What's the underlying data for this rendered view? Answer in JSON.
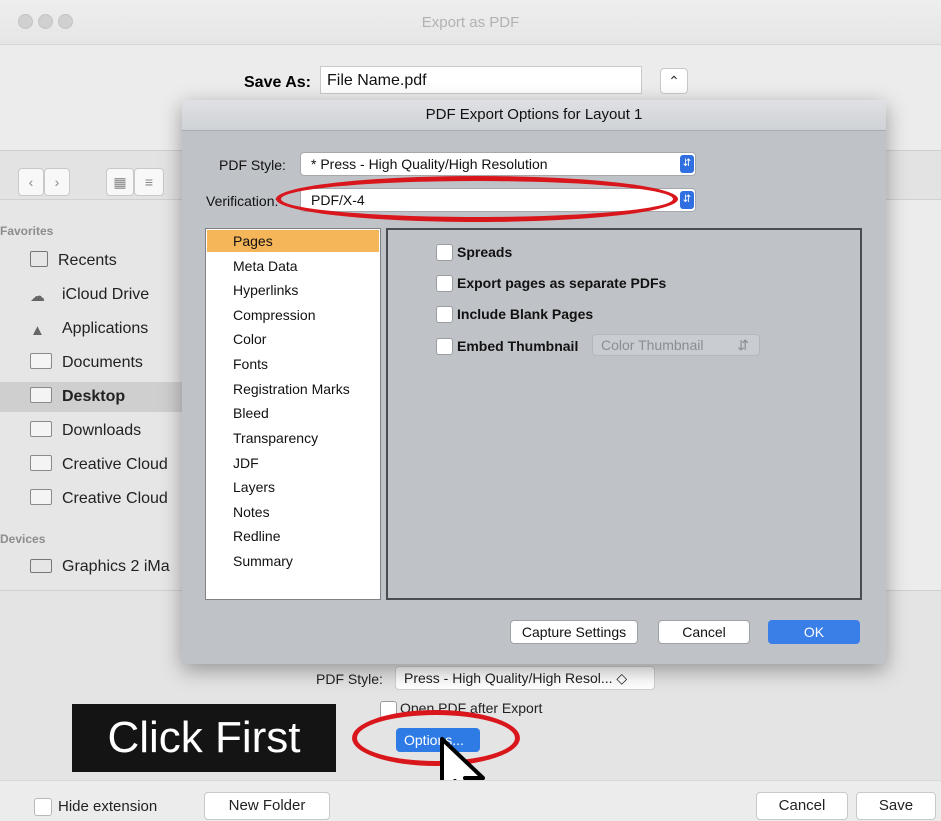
{
  "window": {
    "title": "Export as PDF"
  },
  "save_as": {
    "label": "Save As:",
    "value": "File Name.pdf"
  },
  "sidebar": {
    "favorites_heading": "Favorites",
    "items": [
      {
        "label": "Recents",
        "icon": "recents-icon"
      },
      {
        "label": "iCloud Drive",
        "icon": "cloud-icon"
      },
      {
        "label": "Applications",
        "icon": "applications-icon"
      },
      {
        "label": "Documents",
        "icon": "folder-icon"
      },
      {
        "label": "Desktop",
        "icon": "folder-icon",
        "selected": true
      },
      {
        "label": "Downloads",
        "icon": "folder-icon"
      },
      {
        "label": "Creative Cloud",
        "icon": "folder-icon"
      },
      {
        "label": "Creative Cloud",
        "icon": "folder-icon"
      }
    ],
    "devices_heading": "Devices",
    "devices": [
      {
        "label": "Graphics 2 iMa",
        "icon": "monitor-icon"
      }
    ]
  },
  "dialog": {
    "title": "PDF Export Options for Layout 1",
    "pdf_style_label": "PDF Style:",
    "pdf_style_value": "* Press - High Quality/High Resolution",
    "verification_label": "Verification:",
    "verification_value": "PDF/X-4",
    "categories": [
      "Pages",
      "Meta Data",
      "Hyperlinks",
      "Compression",
      "Color",
      "Fonts",
      "Registration Marks",
      "Bleed",
      "Transparency",
      "JDF",
      "Layers",
      "Notes",
      "Redline",
      "Summary"
    ],
    "selected_category": "Pages",
    "options": {
      "spreads": "Spreads",
      "separate": "Export pages as separate PDFs",
      "blank": "Include Blank Pages",
      "thumbnail": "Embed Thumbnail",
      "thumbnail_type": "Color Thumbnail"
    },
    "buttons": {
      "capture": "Capture Settings",
      "cancel": "Cancel",
      "ok": "OK"
    }
  },
  "bottom": {
    "pdf_style_label": "PDF Style:",
    "pdf_style_value": "Press - High Quality/High Resol... ◇",
    "open_pdf": "Open PDF after Export",
    "options_button": "Options..."
  },
  "annotation": {
    "click_first": "Click First",
    "highlight_color": "#d9161b"
  },
  "footer": {
    "hide_extension": "Hide extension",
    "new_folder": "New Folder",
    "cancel": "Cancel",
    "save": "Save"
  },
  "colors": {
    "accent": "#2f7be6",
    "selection": "#f5b559"
  }
}
